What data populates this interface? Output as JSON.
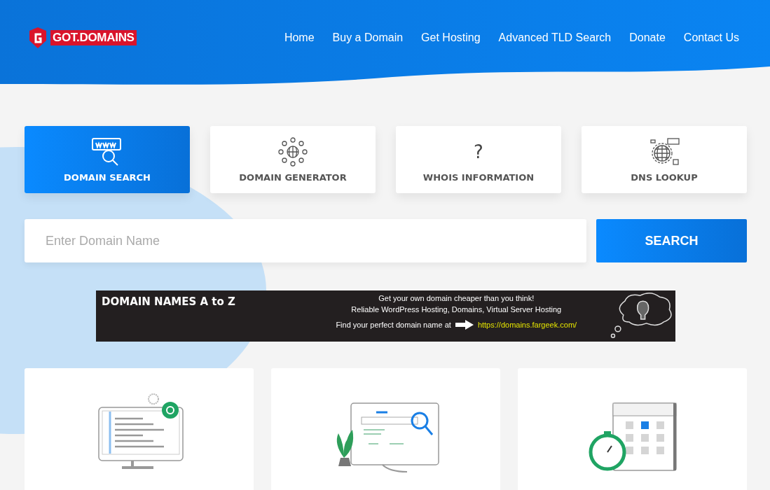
{
  "logo": {
    "text": "GOT.DOMAINS"
  },
  "nav": [
    {
      "label": "Home"
    },
    {
      "label": "Buy a Domain"
    },
    {
      "label": "Get Hosting"
    },
    {
      "label": "Advanced TLD Search"
    },
    {
      "label": "Donate"
    },
    {
      "label": "Contact Us"
    }
  ],
  "tabs": [
    {
      "label": "DOMAIN SEARCH",
      "kind": "www",
      "selected": true
    },
    {
      "label": "DOMAIN GENERATOR",
      "kind": "network",
      "selected": false
    },
    {
      "label": "WHOIS INFORMATION",
      "kind": "question",
      "icon_text": "?",
      "selected": false
    },
    {
      "label": "DNS LOOKUP",
      "kind": "dns",
      "selected": false
    }
  ],
  "search": {
    "placeholder": "Enter Domain Name",
    "button": "SEARCH"
  },
  "banner": {
    "title": "DOMAIN NAMES A to Z",
    "line_1": "Get your own domain cheaper than you think!",
    "line_2": "Reliable WordPress Hosting, Domains, Virtual Server Hosting",
    "line_3": "Find your perfect domain name at",
    "link": "https://domains.fargeek.com/"
  },
  "cards": [
    {
      "kind": "code"
    },
    {
      "kind": "search"
    },
    {
      "kind": "calendar"
    }
  ]
}
